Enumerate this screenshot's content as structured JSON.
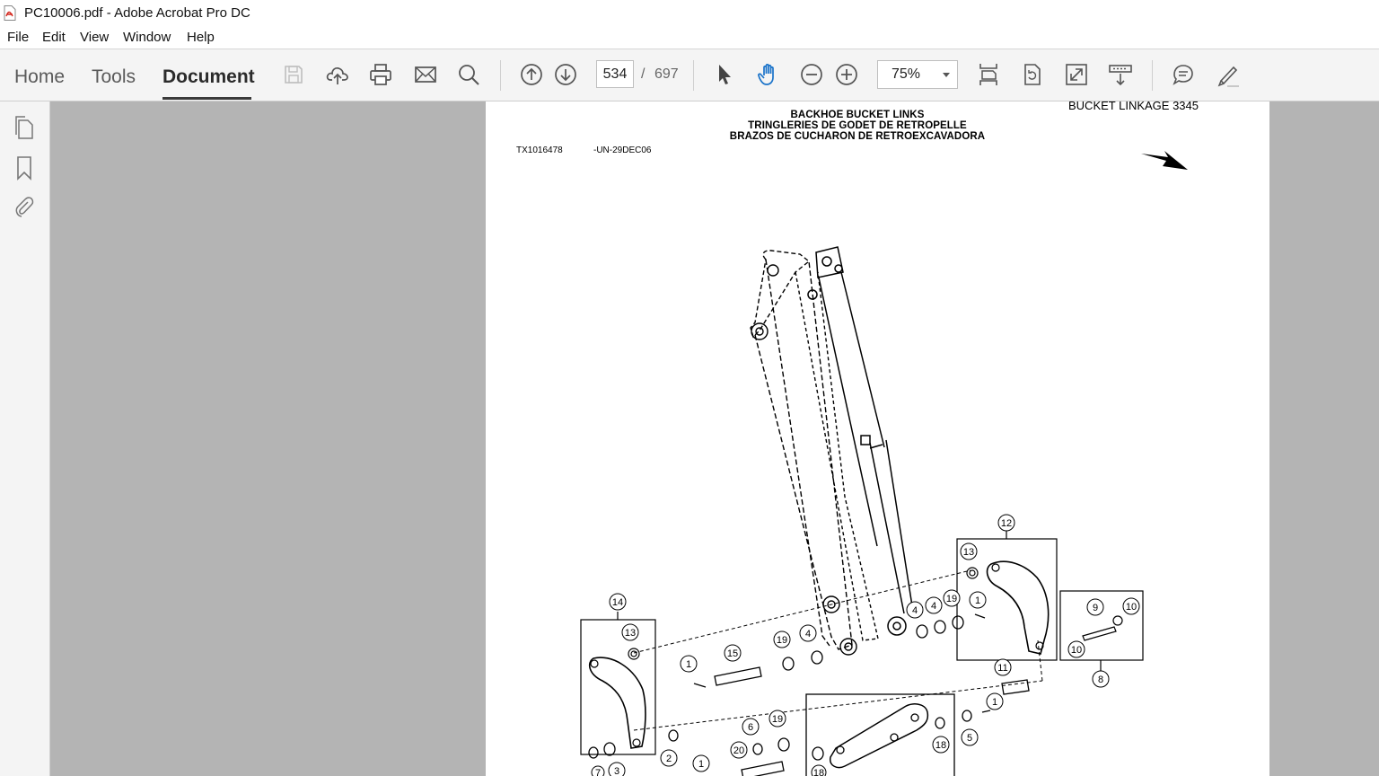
{
  "window": {
    "title": "PC10006.pdf - Adobe Acrobat Pro DC"
  },
  "menu": [
    "File",
    "Edit",
    "View",
    "Window",
    "Help"
  ],
  "tabs": {
    "home": "Home",
    "tools": "Tools",
    "document": "Document",
    "active": "Document"
  },
  "toolbar": {
    "icons": [
      "save-icon",
      "cloud-upload-icon",
      "print-icon",
      "email-icon",
      "search-icon",
      "page-up-icon",
      "page-down-icon",
      "select-cursor-icon",
      "hand-icon",
      "zoom-out-icon",
      "zoom-in-icon",
      "fit-page-icon",
      "rotate-icon",
      "full-screen-icon",
      "scroll-mode-icon",
      "comment-icon",
      "highlight-icon"
    ],
    "page_current": "534",
    "page_separator": "/",
    "page_total": "697",
    "zoom": "75%"
  },
  "leftrail": {
    "icons": [
      "pages-icon",
      "bookmark-icon",
      "attachment-icon"
    ]
  },
  "document": {
    "header_right": "BUCKET LINKAGE 3345",
    "title_lines": [
      "BACKHOE BUCKET LINKS",
      "TRINGLERIES DE GODET DE RETROPELLE",
      "BRAZOS DE CUCHARON DE RETROEXCAVADORA"
    ],
    "ref_code": "TX1016478",
    "ref_date": "-UN-29DEC06",
    "callouts": [
      "12",
      "13",
      "14",
      "13",
      "1",
      "15",
      "19",
      "4",
      "4",
      "4",
      "19",
      "1",
      "9",
      "10",
      "10",
      "8",
      "11",
      "1",
      "5",
      "6",
      "19",
      "20",
      "2",
      "3",
      "7",
      "1",
      "18",
      "18"
    ]
  },
  "colors": {
    "toolbar_bg": "#f4f4f4",
    "doc_bg": "#b4b4b4",
    "page_bg": "#ffffff",
    "icon": "#555555"
  }
}
